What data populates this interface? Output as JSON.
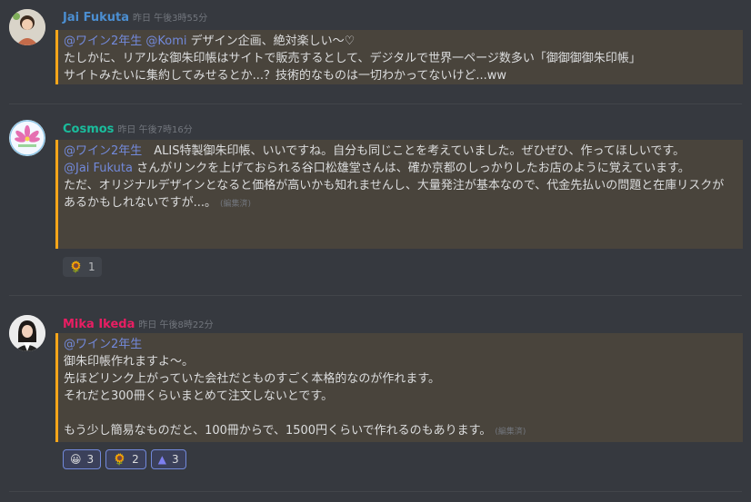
{
  "messages": [
    {
      "author": "Jai Fukuta",
      "author_color": "#4b8ed1",
      "timestamp": "昨日 午後3時55分",
      "avatar_icon": "person-avatar-icon",
      "mentions": [
        "@ワイン2年生",
        "@Komi"
      ],
      "lines": [
        "デザイン企画、絶対楽しい〜♡",
        "たしかに、リアルな御朱印帳はサイトで販売するとして、デジタルで世界一ページ数多い「御御御御朱印帳」",
        "サイトみたいに集約してみせるとか...？技術的なものは一切わかってないけど...ww"
      ]
    },
    {
      "author": "Cosmos",
      "author_color": "#1abc9c",
      "timestamp": "昨日 午後7時16分",
      "avatar_icon": "flower-avatar-icon",
      "mention_first": "@ワイン2年生",
      "text_first": "　ALIS特製御朱印帳、いいですね。自分も同じことを考えていました。ぜひぜひ、作ってほしいです。",
      "mention_second": "@Jai Fukuta",
      "text_second": " さんがリンクを上げておられる谷口松雄堂さんは、確か京都のしっかりしたお店のように覚えています。",
      "text_third": "ただ、オリジナルデザインとなると価格が高いかも知れませんし、大量発注が基本なので、代金先払いの問題と在庫リスクがあるかもしれないですが...。",
      "edited": "(編集済)",
      "reactions": [
        {
          "emoji": "🌻",
          "icon": "sunflower-icon",
          "count": "1"
        }
      ]
    },
    {
      "author": "Mika Ikeda",
      "author_color": "#e91e63",
      "timestamp": "昨日 午後8時22分",
      "avatar_icon": "woman-avatar-icon",
      "mention": "@ワイン2年生",
      "lines": [
        "御朱印帳作れますよ〜。",
        "先ほどリンク上がっていた会社だとものすごく本格的なのが作れます。",
        "それだと300冊くらいまとめて注文しないとです。",
        "",
        "もう少し簡易なものだと、100冊からで、1500円くらいで作れるのもあります。"
      ],
      "edited": "(編集済)",
      "reactions": [
        {
          "emoji": "😀",
          "icon": "grinning-face-icon",
          "count": "3"
        },
        {
          "emoji": "🌻",
          "icon": "sunflower-icon",
          "count": "2"
        },
        {
          "emoji": "▲",
          "icon": "alis-logo-icon",
          "count": "3"
        }
      ]
    }
  ]
}
